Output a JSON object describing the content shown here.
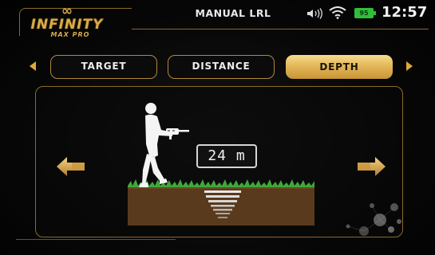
{
  "header": {
    "logo": {
      "mark": "∞",
      "name": "INFINITY",
      "sub": "MAX PRO"
    },
    "title": "MANUAL LRL",
    "status": {
      "volume_icon": "speaker-icon",
      "wifi_icon": "wifi-icon",
      "battery_level": "95",
      "battery_color": "#2fbf3a",
      "time": "12:57"
    }
  },
  "tabs": [
    {
      "label": "TARGET",
      "active": false
    },
    {
      "label": "DISTANCE",
      "active": false
    },
    {
      "label": "DEPTH",
      "active": true
    }
  ],
  "nav": {
    "prev_icon": "chevron-left-icon",
    "next_icon": "chevron-right-icon"
  },
  "panel": {
    "depth_value": "24 m",
    "left_arrow_icon": "arrow-left-icon",
    "right_arrow_icon": "arrow-right-icon",
    "illustration": "man-with-detector-over-ground"
  },
  "colors": {
    "accent": "#d9ab48",
    "tab_active_bg": "#e4b75a",
    "background": "#050505"
  }
}
